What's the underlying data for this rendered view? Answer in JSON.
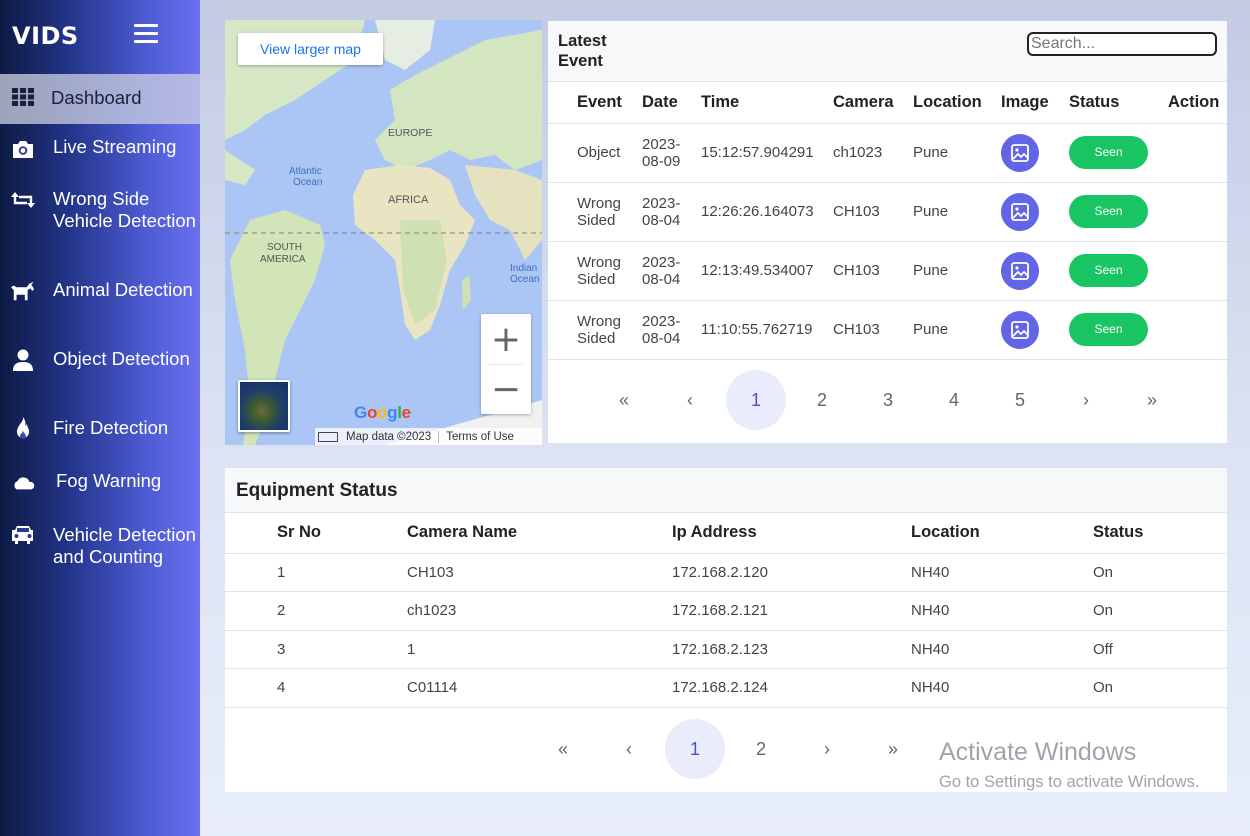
{
  "app": {
    "brand": "VIDS"
  },
  "sidebar": {
    "items": [
      {
        "label": "Dashboard",
        "icon": "grid-icon",
        "active": true
      },
      {
        "label": "Live Streaming",
        "icon": "camera-icon"
      },
      {
        "label": "Wrong Side Vehicle Detection",
        "icon": "retweet-arrows-icon"
      },
      {
        "label": "Animal Detection",
        "icon": "horse-icon"
      },
      {
        "label": "Object Detection",
        "icon": "user-icon"
      },
      {
        "label": "Fire Detection",
        "icon": "fire-icon"
      },
      {
        "label": "Fog Warning",
        "icon": "cloud-icon"
      },
      {
        "label": "Vehicle Detection and Counting",
        "icon": "car-icon"
      }
    ]
  },
  "map": {
    "larger_map_label": "View larger map",
    "labels": {
      "europe": "EUROPE",
      "africa": "AFRICA",
      "south_america": "SOUTH AMERICA",
      "atlantic": "Atlantic Ocean",
      "indian": "Indian Ocean"
    },
    "google": "Google",
    "map_data": "Map data ©2023",
    "terms": "Terms of Use"
  },
  "latest_event": {
    "title": "Latest Event",
    "search_placeholder": "Search...",
    "columns": [
      "Event",
      "Date",
      "Time",
      "Camera",
      "Location",
      "Image",
      "Status",
      "Action"
    ],
    "rows": [
      {
        "event": "Object",
        "date": "2023-08-09",
        "time": "15:12:57.904291",
        "camera": "ch1023",
        "location": "Pune",
        "status": "Seen"
      },
      {
        "event": "Wrong Sided",
        "date": "2023-08-04",
        "time": "12:26:26.164073",
        "camera": "CH103",
        "location": "Pune",
        "status": "Seen"
      },
      {
        "event": "Wrong Sided",
        "date": "2023-08-04",
        "time": "12:13:49.534007",
        "camera": "CH103",
        "location": "Pune",
        "status": "Seen"
      },
      {
        "event": "Wrong Sided",
        "date": "2023-08-04",
        "time": "11:10:55.762719",
        "camera": "CH103",
        "location": "Pune",
        "status": "Seen"
      }
    ],
    "pagination": {
      "first": "«",
      "prev": "‹",
      "pages": [
        "1",
        "2",
        "3",
        "4",
        "5"
      ],
      "current": "1",
      "next": "›",
      "last": "»"
    }
  },
  "equipment": {
    "title": "Equipment Status",
    "columns": [
      "Sr No",
      "Camera Name",
      "Ip Address",
      "Location",
      "Status"
    ],
    "rows": [
      {
        "sr": "1",
        "camera": "CH103",
        "ip": "172.168.2.120",
        "location": "NH40",
        "status": "On"
      },
      {
        "sr": "2",
        "camera": "ch1023",
        "ip": "172.168.2.121",
        "location": "NH40",
        "status": "On"
      },
      {
        "sr": "3",
        "camera": "1",
        "ip": "172.168.2.123",
        "location": "NH40",
        "status": "Off"
      },
      {
        "sr": "4",
        "camera": "C01114",
        "ip": "172.168.2.124",
        "location": "NH40",
        "status": "On"
      }
    ],
    "pagination": {
      "first": "«",
      "prev": "‹",
      "pages": [
        "1",
        "2"
      ],
      "current": "1",
      "next": "›",
      "last": "»"
    }
  },
  "watermark": {
    "line1": "Activate Windows",
    "line2": "Go to Settings to activate Windows."
  }
}
